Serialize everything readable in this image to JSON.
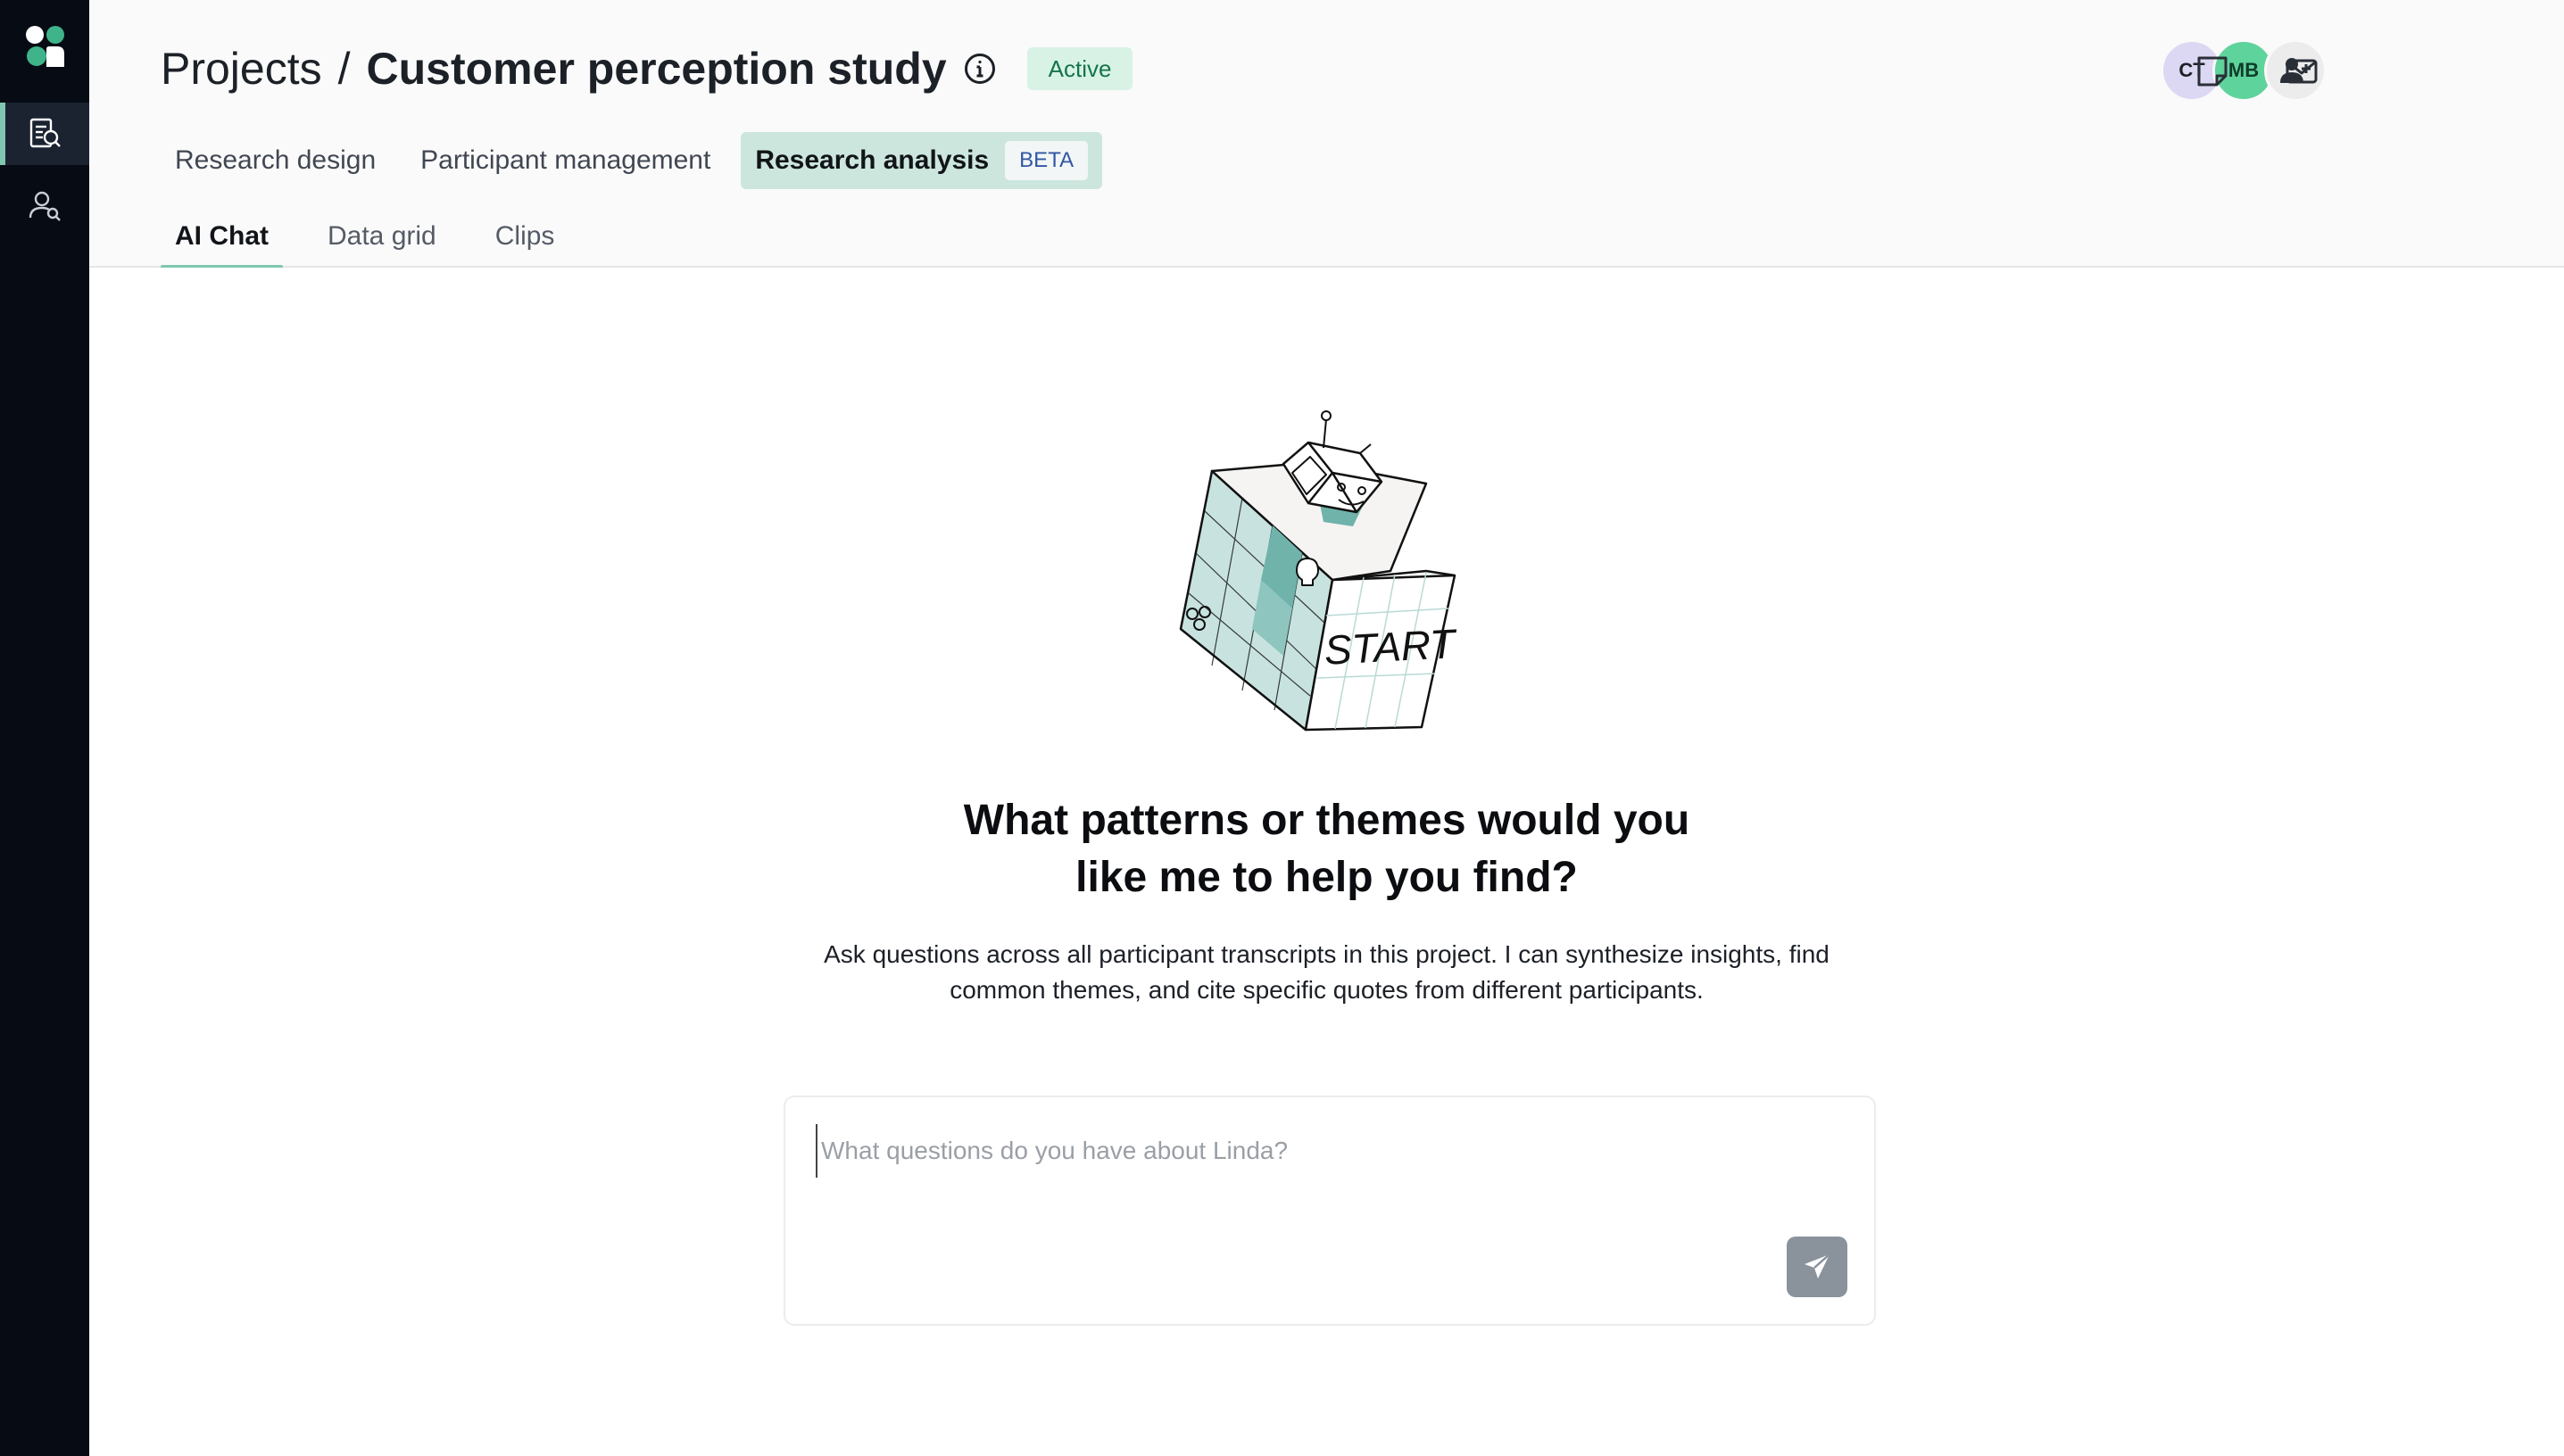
{
  "header": {
    "breadcrumb_root": "Projects",
    "breadcrumb_separator": "/",
    "project_title": "Customer perception study",
    "status": "Active"
  },
  "collaborators": [
    {
      "initials": "CT",
      "color": "#dcd7f2"
    },
    {
      "initials": "MB",
      "color": "#5fd39c"
    }
  ],
  "section_tabs": [
    {
      "label": "Research design",
      "active": false
    },
    {
      "label": "Participant management",
      "active": false
    },
    {
      "label": "Research analysis",
      "active": true,
      "badge": "BETA"
    }
  ],
  "sub_tabs": [
    {
      "label": "AI Chat",
      "active": true
    },
    {
      "label": "Data grid",
      "active": false
    },
    {
      "label": "Clips",
      "active": false
    }
  ],
  "illustration": {
    "cube_text": "START"
  },
  "chat": {
    "title_line1": "What patterns or themes would you",
    "title_line2": "like me to help you find?",
    "description_line1": "Ask questions across all participant transcripts in this project. I can synthesize insights, find",
    "description_line2": "common themes, and cite specific quotes from different participants.",
    "placeholder": "What questions do you have about Linda?"
  },
  "icons": {
    "rail": [
      "logo-icon",
      "research-doc-icon",
      "participants-icon"
    ],
    "header": [
      "info-icon",
      "add-user-icon",
      "notes-icon",
      "mail-icon"
    ],
    "send": "send-icon"
  },
  "colors": {
    "rail_bg": "#060b14",
    "accent": "#7fc7b0",
    "active_tab_bg": "#cce6dd",
    "status_bg": "#d8f3e6",
    "status_text": "#15744a",
    "send_button": "#8a929c"
  }
}
